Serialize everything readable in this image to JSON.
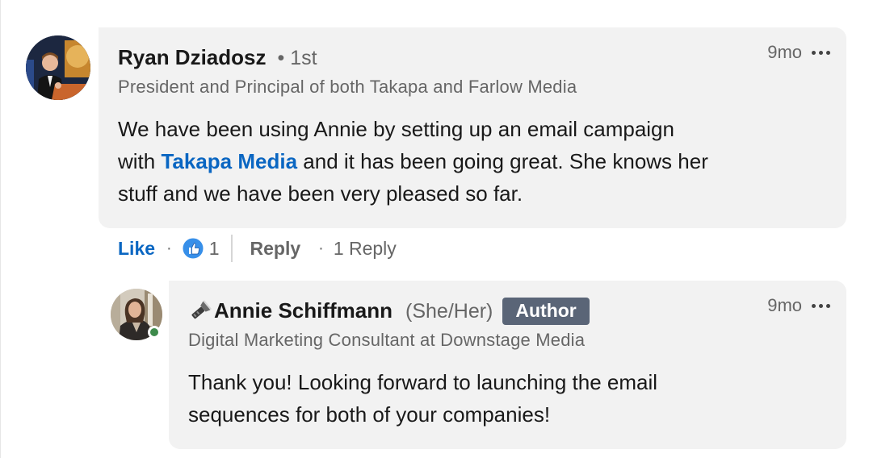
{
  "comment": {
    "author": "Ryan Dziadosz",
    "degree": "• 1st",
    "headline": "President and Principal of both Takapa and Farlow Media",
    "timestamp": "9mo",
    "text": {
      "line1": "We have been using Annie by setting up an email campaign",
      "line2_before": "with ",
      "mention": "Takapa Media",
      "line2_after": " and it has been going great. She knows her",
      "line3": "stuff and we have been very pleased so far."
    },
    "more_icon": "more-horizontal-icon",
    "avatar_icon": "profile-photo"
  },
  "actions": {
    "like_label": "Like",
    "separator": "·",
    "reaction_icon": "thumbs-up-icon",
    "reaction_count": "1",
    "reply_label": "Reply",
    "replies_label": "1 Reply"
  },
  "reply": {
    "author": "Annie Schiffmann",
    "name_prefix_icon": "flashlight-icon",
    "pronouns": "(She/Her)",
    "badge": "Author",
    "headline": "Digital Marketing Consultant at Downstage Media",
    "timestamp": "9mo",
    "text": {
      "line1": "Thank you! Looking forward to launching the email",
      "line2": "sequences for both of your companies!"
    },
    "presence_status": "online",
    "presence_color": "#3d8a4b"
  },
  "colors": {
    "bubble": "#f2f2f2",
    "link_blue": "#0a66c2",
    "secondary_text": "#666666",
    "badge_bg": "#5a6577"
  }
}
